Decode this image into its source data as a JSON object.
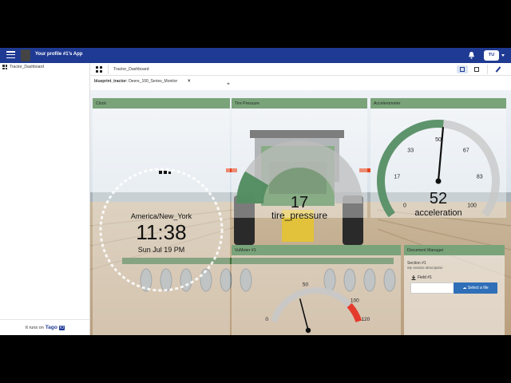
{
  "header": {
    "app_title": "Your profile #1's App",
    "user_initials": "TU"
  },
  "sidebar": {
    "items": [
      {
        "label": "Tractor_Dashboard"
      }
    ],
    "footer_prefix": "It runs on",
    "footer_brand": "Tago",
    "footer_brand_suffix": "IO"
  },
  "dashboard": {
    "name": "Tractor_Dashboard"
  },
  "filter": {
    "key": "blueprint_tractor:",
    "value": "Deere_100_Series_Monitor"
  },
  "widgets": {
    "clock": {
      "title": "Clock",
      "timezone": "America/New_York",
      "time": "11:38",
      "date": "Sun Jul 19 PM"
    },
    "tire_pressure": {
      "title": "Tire Pressure",
      "value": "17",
      "variable": "tire_pressure",
      "fill_fraction": 0.17
    },
    "accelerometer": {
      "title": "Accelerometer",
      "value": "52",
      "variable": "acceleration",
      "min": 0,
      "max": 100,
      "ticks": [
        "0",
        "17",
        "33",
        "50",
        "67",
        "83",
        "100"
      ],
      "needle_value": 52
    },
    "vumeter": {
      "title": "VuMeter #1",
      "min": 0,
      "max": 120,
      "ticks": [
        "0",
        "50",
        "100",
        "120"
      ],
      "needle_value": 40
    },
    "document_manager": {
      "title": "Document Manager",
      "section": "Section #1",
      "description": "My section description",
      "field_label": "Field #1",
      "button_label": "Select a file"
    }
  },
  "colors": {
    "topbar": "#1f3a93",
    "widget_header": "#7aa37a",
    "gauge_fill": "#4a8a5a",
    "vumeter_red": "#e53b2c"
  }
}
